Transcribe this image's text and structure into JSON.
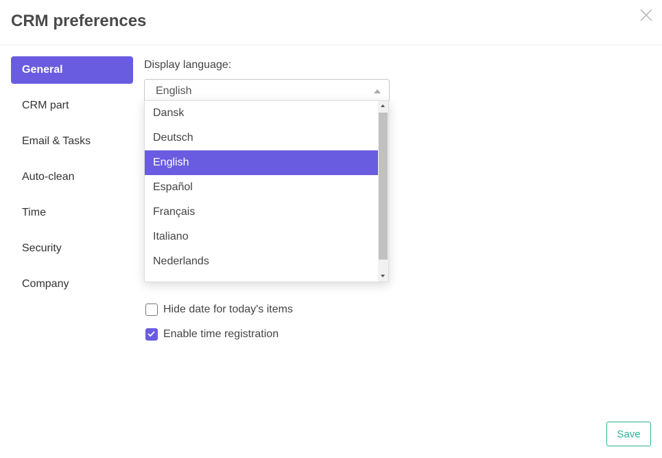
{
  "modal": {
    "title": "CRM preferences"
  },
  "sidebar": {
    "items": [
      {
        "label": "General",
        "active": true
      },
      {
        "label": "CRM part",
        "active": false
      },
      {
        "label": "Email & Tasks",
        "active": false
      },
      {
        "label": "Auto-clean",
        "active": false
      },
      {
        "label": "Time",
        "active": false
      },
      {
        "label": "Security",
        "active": false
      },
      {
        "label": "Company",
        "active": false
      }
    ]
  },
  "general": {
    "display_language_label": "Display language:",
    "display_language_value": "English",
    "language_options": [
      "Dansk",
      "Deutsch",
      "English",
      "Español",
      "Français",
      "Italiano",
      "Nederlands"
    ],
    "selected_option": "English",
    "hide_date_label": "Hide date for today's items",
    "hide_date_checked": false,
    "enable_time_label": "Enable time registration",
    "enable_time_checked": true
  },
  "footer": {
    "save_label": "Save"
  },
  "colors": {
    "accent": "#6a5ce0",
    "save_button": "#27b39a"
  },
  "icons": {
    "close": "close-icon",
    "dropdown": "chevron-up-icon",
    "checkbox": "check-icon"
  }
}
